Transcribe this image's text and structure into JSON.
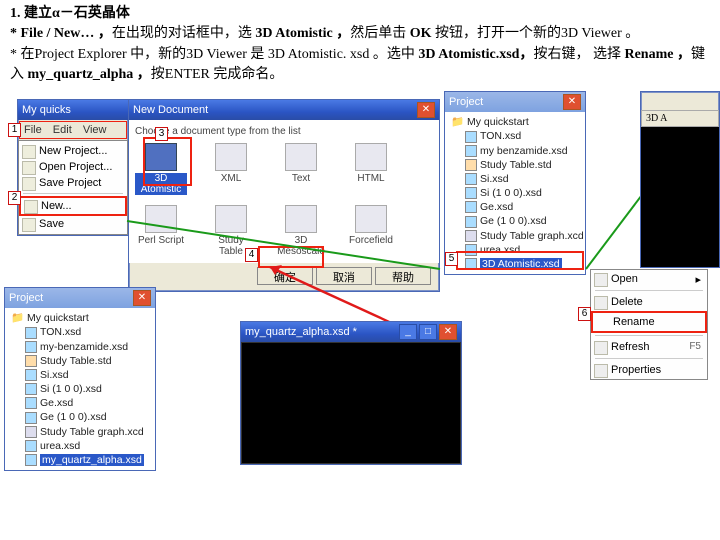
{
  "instructions": {
    "heading": "1. 建立α－石英晶体",
    "line1_a": "* File / New… ，",
    "line1_b": "在出现的对话框中，选",
    "line1_c": " 3D Atomistic ，",
    "line1_d": "然后单击",
    "line1_e": " OK ",
    "line1_f": "按钮，打开一个新的3D Viewer 。",
    "line2_a": "* 在Project Explorer 中，新的3D Viewer 是 3D Atomistic. xsd 。选中",
    "line2_b": " 3D Atomistic.xsd，",
    "line2_c": "按右键， 选择",
    "line2_d": " Rename ，",
    "line2_e": "键入",
    "line2_f": " my_quartz_alpha ，",
    "line2_g": "按ENTER 完成命名。"
  },
  "mainwin": {
    "title": "My quicks",
    "menu_file": "File",
    "menu_edit": "Edit",
    "menu_view": "View"
  },
  "filemenu": {
    "newproject": "New Project...",
    "openproject": "Open Project...",
    "saveproject": "Save Project",
    "new": "New...",
    "save": "Save"
  },
  "newdoc": {
    "title": "New Document",
    "hint": "Choose a document type from the list",
    "icons": [
      "3D Atomistic",
      "XML",
      "Text",
      "HTML",
      "Perl Script",
      "Study Table",
      "3D Mesoscale",
      "Forcefield"
    ],
    "ok": "确定",
    "cancel": "取消",
    "help": "帮助"
  },
  "project1": {
    "title": "Project",
    "root": "My quickstart",
    "items": [
      "TON.xsd",
      "my benzamide.xsd",
      "Study Table.std",
      "Si.xsd",
      "Si (1 0 0).xsd",
      "Ge.xsd",
      "Ge (1 0 0).xsd",
      "Study Table graph.xcd",
      "urea.xsd",
      "3D Atomistic.xsd"
    ]
  },
  "project2": {
    "title": "Project",
    "root": "My quickstart",
    "items": [
      "TON.xsd",
      "my-benzamide.xsd",
      "Study Table.std",
      "Si.xsd",
      "Si (1 0 0).xsd",
      "Ge.xsd",
      "Ge (1 0 0).xsd",
      "Study Table graph.xcd",
      "urea.xsd",
      "my_quartz_alpha.xsd"
    ]
  },
  "viewer": {
    "title": "my_quartz_alpha.xsd *"
  },
  "viewer2": {
    "title": "3D A"
  },
  "ctx": {
    "open": "Open",
    "delete": "Delete",
    "rename": "Rename",
    "refresh": "Refresh",
    "refresh_key": "F5",
    "props": "Properties"
  },
  "tags": {
    "t1": "1",
    "t2": "2",
    "t3": "3",
    "t4": "4",
    "t5": "5",
    "t6": "6"
  }
}
